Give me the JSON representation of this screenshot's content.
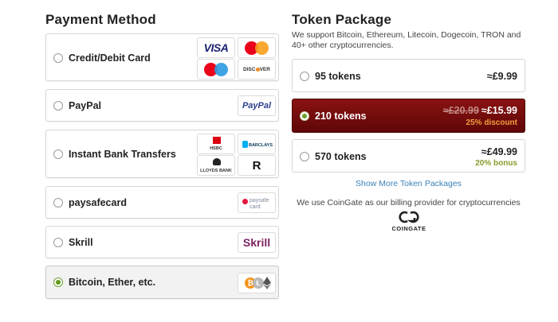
{
  "payment": {
    "title": "Payment Method",
    "methods": [
      {
        "label": "Credit/Debit Card",
        "selected": false
      },
      {
        "label": "PayPal",
        "selected": false
      },
      {
        "label": "Instant Bank Transfers",
        "selected": false
      },
      {
        "label": "paysafecard",
        "selected": false
      },
      {
        "label": "Skrill",
        "selected": false
      },
      {
        "label": "Bitcoin, Ether, etc.",
        "selected": true
      }
    ],
    "logos": {
      "visa": "VISA",
      "discover": "DISC",
      "discover_end": "VER",
      "paypal": "PayPal",
      "hsbc": "HSBC",
      "barclays": "BARCLAYS",
      "lloyds": "LLOYDS BANK",
      "paysafe_line1": "paysafe",
      "paysafe_line2": "card",
      "skrill": "Skrill"
    }
  },
  "tokens": {
    "title": "Token Package",
    "description": "We support Bitcoin, Ethereum, Litecoin, Dogecoin, TRON and 40+ other cryptocurrencies.",
    "packages": [
      {
        "label": "95 tokens",
        "price": "≈£9.99",
        "old_price": "",
        "note": "",
        "selected": false
      },
      {
        "label": "210 tokens",
        "price": "≈£15.99",
        "old_price": "≈£20.99",
        "note": "25% discount",
        "selected": true
      },
      {
        "label": "570 tokens",
        "price": "≈£49.99",
        "old_price": "",
        "note": "20% bonus",
        "selected": false
      }
    ],
    "show_more": "Show More Token Packages",
    "provider_text": "We use CoinGate as our billing provider for cryptocurrencies",
    "provider_logo": "COINGATE"
  },
  "colors": {
    "selected_package": "#7a0d0d",
    "discount_note": "#f0a040",
    "bonus_note": "#8a9a2a",
    "link": "#3b82b8",
    "radio_on": "#5e9a1f"
  }
}
